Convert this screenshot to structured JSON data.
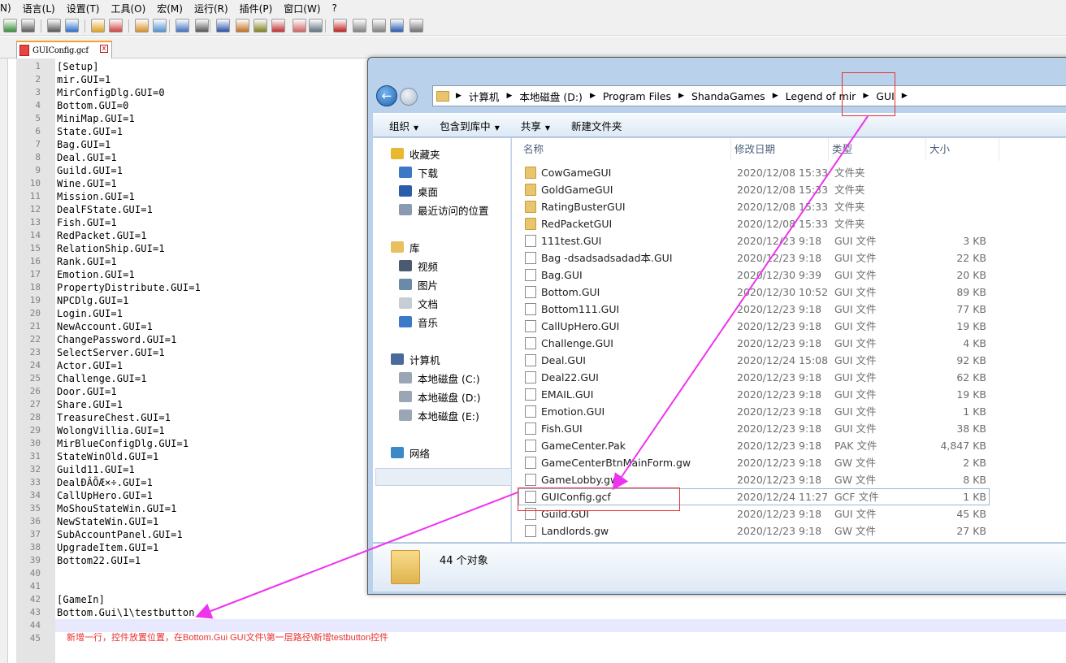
{
  "menubar": [
    "N)",
    "语言(L)",
    "设置(T)",
    "工具(O)",
    "宏(M)",
    "运行(R)",
    "插件(P)",
    "窗口(W)",
    "?"
  ],
  "editor_tab": {
    "filename": "GUIConfig.gcf",
    "close_glyph": "x"
  },
  "editor_lines": [
    "[Setup]",
    "mir.GUI=1",
    "MirConfigDlg.GUI=0",
    "Bottom.GUI=0",
    "MiniMap.GUI=1",
    "State.GUI=1",
    "Bag.GUI=1",
    "Deal.GUI=1",
    "Guild.GUI=1",
    "Wine.GUI=1",
    "Mission.GUI=1",
    "DealFState.GUI=1",
    "Fish.GUI=1",
    "RedPacket.GUI=1",
    "RelationShip.GUI=1",
    "Rank.GUI=1",
    "Emotion.GUI=1",
    "PropertyDistribute.GUI=1",
    "NPCDlg.GUI=1",
    "Login.GUI=1",
    "NewAccount.GUI=1",
    "ChangePassword.GUI=1",
    "SelectServer.GUI=1",
    "Actor.GUI=1",
    "Challenge.GUI=1",
    "Door.GUI=1",
    "Share.GUI=1",
    "TreasureChest.GUI=1",
    "WolongVillia.GUI=1",
    "MirBlueConfigDlg.GUI=1",
    "StateWinOld.GUI=1",
    "Guild11.GUI=1",
    "DealÐÂÕÆ×÷.GUI=1",
    "CallUpHero.GUI=1",
    "MoShouStateWin.GUI=1",
    "NewStateWin.GUI=1",
    "SubAccountPanel.GUI=1",
    "UpgradeItem.GUI=1",
    "Bottom22.GUI=1",
    "",
    "",
    "[GameIn]",
    "Bottom.Gui\\1\\testbutton",
    "",
    ""
  ],
  "annotation_comment": "新增一行，控件放置位置，在Bottom.Gui  GUI文件\\第一层路径\\新增testbutton控件",
  "explorer": {
    "breadcrumbs": [
      "计算机",
      "本地磁盘 (D:)",
      "Program Files",
      "ShandaGames",
      "Legend of mir",
      "GUI"
    ],
    "commands": [
      {
        "label": "组织",
        "dropdown": true
      },
      {
        "label": "包含到库中",
        "dropdown": true
      },
      {
        "label": "共享",
        "dropdown": true
      },
      {
        "label": "新建文件夹",
        "dropdown": false
      }
    ],
    "nav": {
      "favorites_title": "收藏夹",
      "favorites": [
        "下载",
        "桌面",
        "最近访问的位置"
      ],
      "libraries_title": "库",
      "libraries": [
        "视频",
        "图片",
        "文档",
        "音乐"
      ],
      "computer_title": "计算机",
      "drives": [
        "本地磁盘 (C:)",
        "本地磁盘 (D:)",
        "本地磁盘 (E:)"
      ],
      "network_title": "网络"
    },
    "columns": [
      "名称",
      "修改日期",
      "类型",
      "大小"
    ],
    "files": [
      {
        "name": "CowGameGUI",
        "date": "2020/12/08 15:33",
        "type": "文件夹",
        "size": "",
        "kind": "folder"
      },
      {
        "name": "GoldGameGUI",
        "date": "2020/12/08 15:33",
        "type": "文件夹",
        "size": "",
        "kind": "folder"
      },
      {
        "name": "RatingBusterGUI",
        "date": "2020/12/08 15:33",
        "type": "文件夹",
        "size": "",
        "kind": "folder"
      },
      {
        "name": "RedPacketGUI",
        "date": "2020/12/08 15:33",
        "type": "文件夹",
        "size": "",
        "kind": "folder"
      },
      {
        "name": "111test.GUI",
        "date": "2020/12/23 9:18",
        "type": "GUI 文件",
        "size": "3 KB",
        "kind": "doc"
      },
      {
        "name": "Bag -dsadsadsadad本.GUI",
        "date": "2020/12/23 9:18",
        "type": "GUI 文件",
        "size": "22 KB",
        "kind": "doc"
      },
      {
        "name": "Bag.GUI",
        "date": "2020/12/30 9:39",
        "type": "GUI 文件",
        "size": "20 KB",
        "kind": "doc"
      },
      {
        "name": "Bottom.GUI",
        "date": "2020/12/30 10:52",
        "type": "GUI 文件",
        "size": "89 KB",
        "kind": "doc"
      },
      {
        "name": "Bottom111.GUI",
        "date": "2020/12/23 9:18",
        "type": "GUI 文件",
        "size": "77 KB",
        "kind": "doc"
      },
      {
        "name": "CallUpHero.GUI",
        "date": "2020/12/23 9:18",
        "type": "GUI 文件",
        "size": "19 KB",
        "kind": "doc"
      },
      {
        "name": "Challenge.GUI",
        "date": "2020/12/23 9:18",
        "type": "GUI 文件",
        "size": "4 KB",
        "kind": "doc"
      },
      {
        "name": "Deal.GUI",
        "date": "2020/12/24 15:08",
        "type": "GUI 文件",
        "size": "92 KB",
        "kind": "doc"
      },
      {
        "name": "Deal22.GUI",
        "date": "2020/12/23 9:18",
        "type": "GUI 文件",
        "size": "62 KB",
        "kind": "doc"
      },
      {
        "name": "EMAIL.GUI",
        "date": "2020/12/23 9:18",
        "type": "GUI 文件",
        "size": "19 KB",
        "kind": "doc"
      },
      {
        "name": "Emotion.GUI",
        "date": "2020/12/23 9:18",
        "type": "GUI 文件",
        "size": "1 KB",
        "kind": "doc"
      },
      {
        "name": "Fish.GUI",
        "date": "2020/12/23 9:18",
        "type": "GUI 文件",
        "size": "38 KB",
        "kind": "doc"
      },
      {
        "name": "GameCenter.Pak",
        "date": "2020/12/23 9:18",
        "type": "PAK 文件",
        "size": "4,847 KB",
        "kind": "doc"
      },
      {
        "name": "GameCenterBtnMainForm.gw",
        "date": "2020/12/23 9:18",
        "type": "GW 文件",
        "size": "2 KB",
        "kind": "doc"
      },
      {
        "name": "GameLobby.gw",
        "date": "2020/12/23 9:18",
        "type": "GW 文件",
        "size": "8 KB",
        "kind": "doc"
      },
      {
        "name": "GUIConfig.gcf",
        "date": "2020/12/24 11:27",
        "type": "GCF 文件",
        "size": "1 KB",
        "kind": "doc"
      },
      {
        "name": "Guild.GUI",
        "date": "2020/12/23 9:18",
        "type": "GUI 文件",
        "size": "45 KB",
        "kind": "doc"
      },
      {
        "name": "Landlords.gw",
        "date": "2020/12/23 9:18",
        "type": "GW 文件",
        "size": "27 KB",
        "kind": "doc"
      }
    ],
    "status": "44 个对象"
  },
  "colors": {
    "annotation": "#e8322f",
    "arrow": "#ee33ee",
    "tab_accent": "#f7a12b"
  }
}
